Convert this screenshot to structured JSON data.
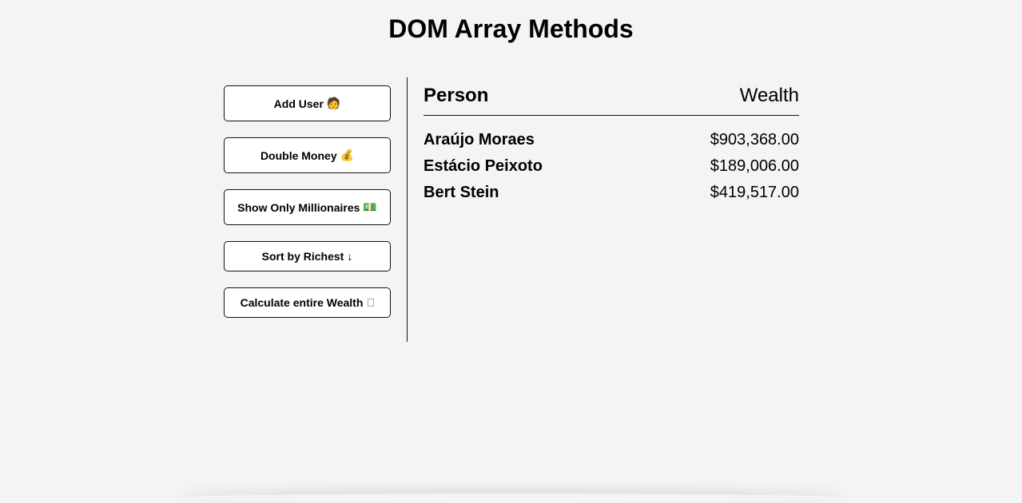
{
  "page": {
    "title": "DOM Array Methods"
  },
  "actions": [
    {
      "label": "Add User",
      "icon": "🧑",
      "icon_name": "person-icon"
    },
    {
      "label": "Double Money",
      "icon": "💰",
      "icon_name": "money-bag-icon"
    },
    {
      "label": "Show Only Millionaires",
      "icon": "💵",
      "icon_name": "banknote-icon"
    },
    {
      "label": "Sort by Richest",
      "icon": "↓",
      "icon_name": "arrow-down-icon"
    },
    {
      "label": "Calculate entire Wealth",
      "icon": "",
      "icon_name": "missing-glyph-icon"
    }
  ],
  "table": {
    "header_person": "Person",
    "header_wealth": "Wealth",
    "rows": [
      {
        "name": "Araújo Moraes",
        "wealth": "$903,368.00"
      },
      {
        "name": "Estácio Peixoto",
        "wealth": "$189,006.00"
      },
      {
        "name": "Bert Stein",
        "wealth": "$419,517.00"
      }
    ]
  },
  "colors": {
    "background": "#f4f4f4",
    "button_background": "#ffffff",
    "border": "#111111",
    "text": "#000000"
  }
}
